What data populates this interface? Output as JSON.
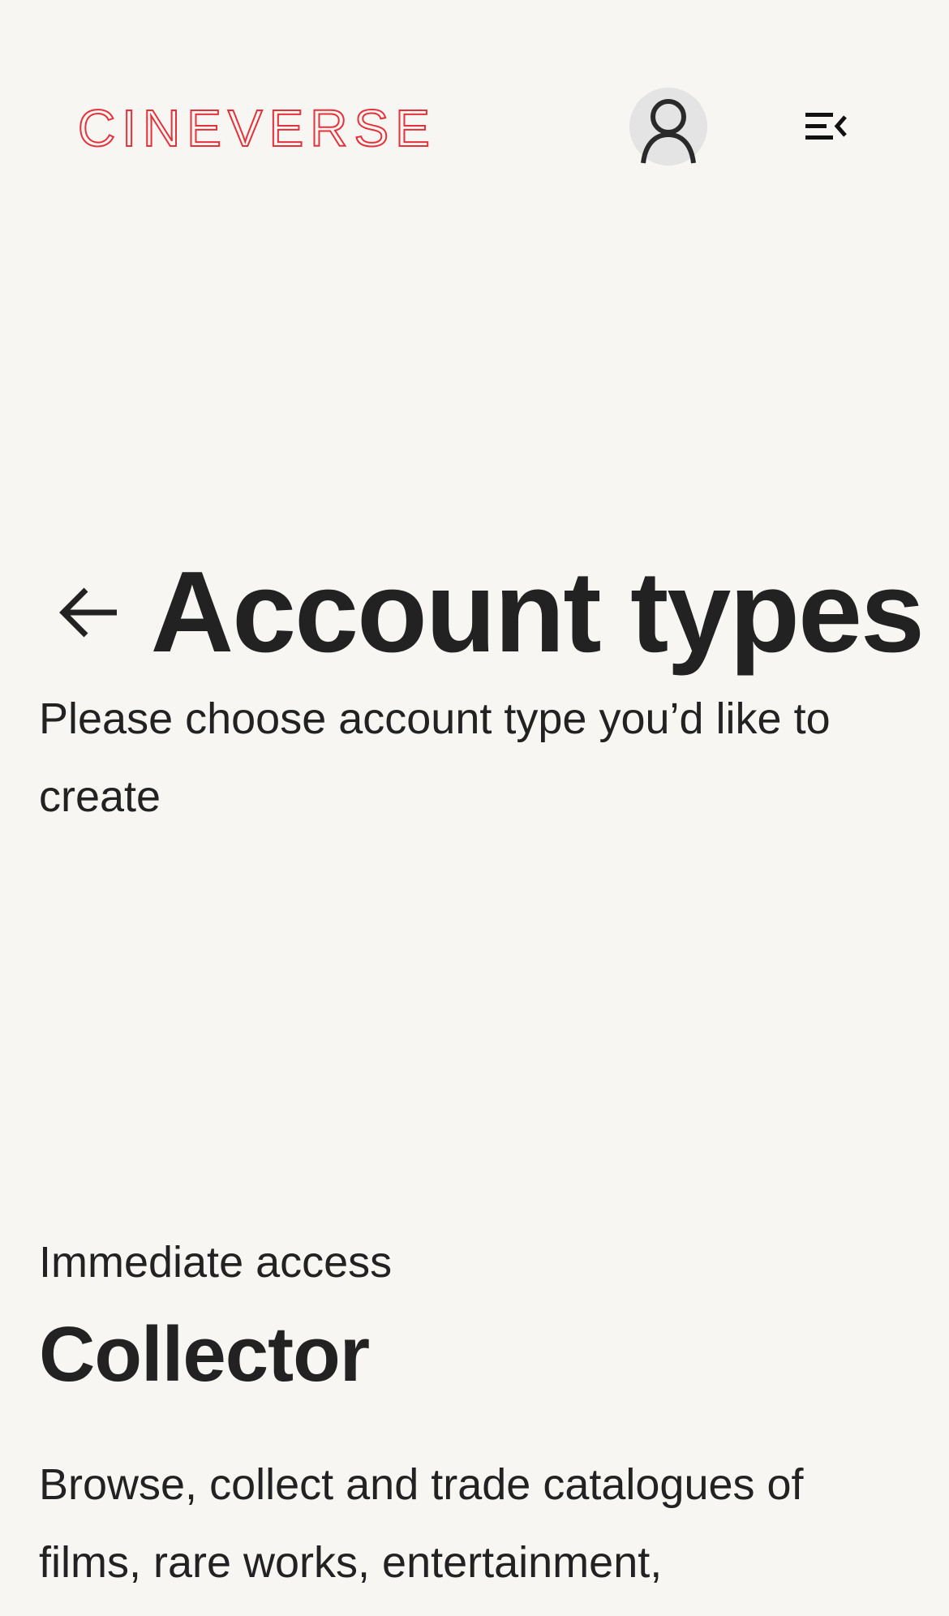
{
  "header": {
    "logo_text": "CINEVERSE",
    "avatar_icon": "user-icon",
    "menu_icon": "menu-collapse-icon"
  },
  "main": {
    "back_icon": "arrow-left-icon",
    "title": "Account types",
    "subtitle": "Please choose account type you’d like to create"
  },
  "account_type": {
    "eyebrow": "Immediate access",
    "name": "Collector",
    "description": "Browse, collect and trade catalogues of films, rare works, entertainment,"
  },
  "colors": {
    "brand": "#e5313a",
    "background": "#f7f6f3",
    "text": "#222222",
    "avatar_bg": "#e4e4e4"
  }
}
